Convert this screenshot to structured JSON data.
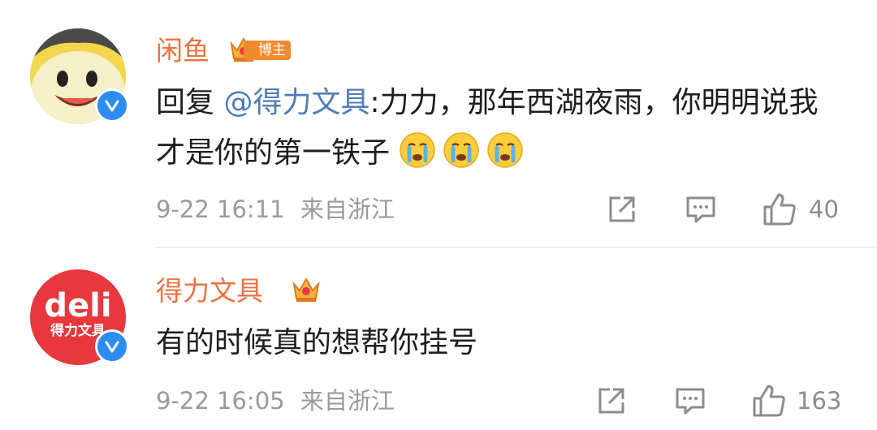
{
  "comments": [
    {
      "author": "闲鱼",
      "author_tag": "博主",
      "reply_prefix": "回复 ",
      "mention": "@得力文具",
      "text_after_mention": ":力力，那年西湖夜雨，你明明说我才是你的第一铁子",
      "emojis": [
        "crying-emoji",
        "crying-emoji",
        "crying-emoji"
      ],
      "time": "9-22 16:11",
      "location": "来自浙江",
      "likes": "40",
      "avatar": "xianyu-penguin-avatar",
      "verified": true
    },
    {
      "author": "得力文具",
      "text": "有的时候真的想帮你挂号",
      "time": "9-22 16:05",
      "location": "来自浙江",
      "likes": "163",
      "avatar_logo_text": "deli",
      "avatar_sub_text": "得力文具",
      "verified": true
    }
  ],
  "colors": {
    "name": "#eb7340",
    "mention": "#4f7cb8",
    "meta": "#9a9a9a",
    "verified_badge": "#2d8cf0",
    "deli_red": "#e8383d"
  }
}
